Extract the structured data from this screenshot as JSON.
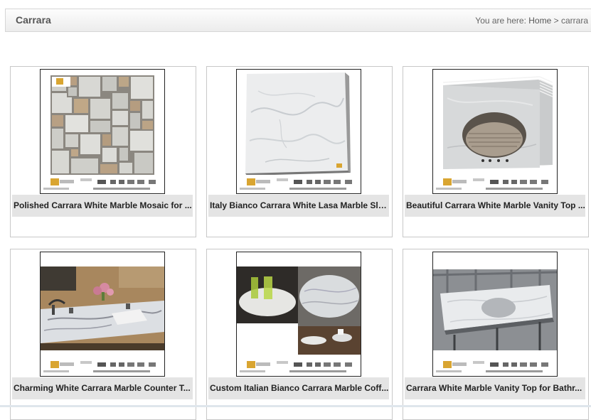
{
  "page": {
    "title": "Carrara",
    "breadcrumb": {
      "prefix": "You are here:",
      "home": "Home",
      "separator": ">",
      "current": "carrara"
    }
  },
  "products": [
    {
      "name": "Polished Carrara White Marble Mosaic for ...",
      "image": "mosaic-tiles"
    },
    {
      "name": "Italy Bianco Carrara White Lasa Marble Sla...",
      "image": "marble-slab"
    },
    {
      "name": "Beautiful Carrara White Marble Vanity Top ...",
      "image": "vanity-top-stack"
    },
    {
      "name": "Charming White Carrara Marble Counter T...",
      "image": "bathroom-counter"
    },
    {
      "name": "Custom Italian Bianco Carrara Marble Coff...",
      "image": "coffee-tables"
    },
    {
      "name": "Carrara White Marble Vanity Top for Bathr...",
      "image": "vanity-top-sink"
    }
  ],
  "watermark": {
    "site": "www.china-stone-experts.com",
    "export_text": "Export since 1998",
    "certs": [
      "MIA",
      "SGS",
      "CE"
    ]
  }
}
